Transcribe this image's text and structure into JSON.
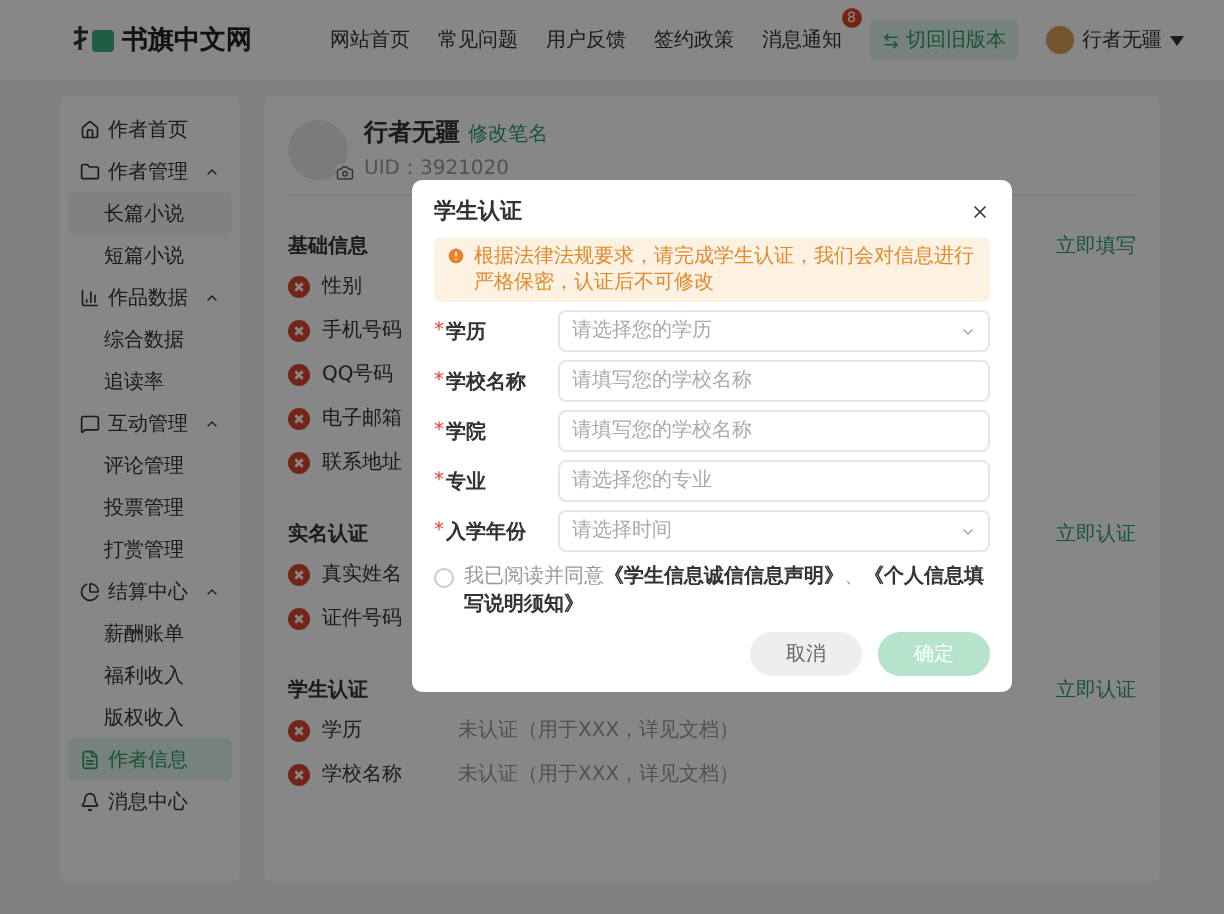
{
  "header": {
    "logo": "书旗中文网",
    "nav": [
      {
        "label": "网站首页"
      },
      {
        "label": "常见问题"
      },
      {
        "label": "用户反馈"
      },
      {
        "label": "签约政策"
      },
      {
        "label": "消息通知",
        "badge": "8"
      }
    ],
    "switch_button": "切回旧版本",
    "user": "行者无疆"
  },
  "sidebar": {
    "items": [
      {
        "label": "作者首页",
        "selected": false
      },
      {
        "label": "作者管理",
        "selected": false,
        "expanded": true,
        "children": [
          {
            "label": "长篇小说",
            "selected": false,
            "hovered": true
          },
          {
            "label": "短篇小说",
            "selected": false,
            "hovered": false
          }
        ]
      },
      {
        "label": "作品数据",
        "selected": false,
        "expanded": true,
        "children": [
          {
            "label": "综合数据",
            "selected": false,
            "hovered": false
          },
          {
            "label": "追读率",
            "selected": false,
            "hovered": false
          }
        ]
      },
      {
        "label": "互动管理",
        "selected": false,
        "expanded": true,
        "children": [
          {
            "label": "评论管理",
            "selected": false,
            "hovered": false
          },
          {
            "label": "投票管理",
            "selected": false,
            "hovered": false
          },
          {
            "label": "打赏管理",
            "selected": false,
            "hovered": false
          }
        ]
      },
      {
        "label": "结算中心",
        "selected": false,
        "expanded": true,
        "children": [
          {
            "label": "薪酬账单",
            "selected": false,
            "hovered": false
          },
          {
            "label": "福利收入",
            "selected": false,
            "hovered": false
          },
          {
            "label": "版权收入",
            "selected": false,
            "hovered": false
          }
        ]
      },
      {
        "label": "作者信息",
        "selected": true
      },
      {
        "label": "消息中心",
        "selected": false
      }
    ]
  },
  "profile": {
    "name": "行者无疆",
    "edit_link": "修改笔名",
    "uid": "UID：3921020"
  },
  "sections": [
    {
      "title": "基础信息",
      "action": "立即填写",
      "rows": [
        {
          "label": "性别",
          "verified": false
        },
        {
          "label": "手机号码",
          "verified": false
        },
        {
          "label": "QQ号码",
          "verified": false
        },
        {
          "label": "电子邮箱",
          "verified": false
        },
        {
          "label": "联系地址",
          "verified": false
        }
      ]
    },
    {
      "title": "实名认证",
      "action": "立即认证",
      "rows": [
        {
          "label": "真实姓名",
          "verified": false
        },
        {
          "label": "证件号码",
          "verified": false
        }
      ]
    },
    {
      "title": "学生认证",
      "action": "立即认证",
      "rows": [
        {
          "label": "学历",
          "verified": false,
          "value": "未认证（用于XXX，详见文档）"
        },
        {
          "label": "学校名称",
          "verified": false,
          "value": "未认证（用于XXX，详见文档）"
        }
      ]
    }
  ],
  "dialog": {
    "title": "学生认证",
    "notice": "根据法律法规要求，请完成学生认证，我们会对信息进行严格保密，认证后不可修改",
    "fields": [
      {
        "required_mark": "*",
        "label": "学历",
        "kind": "select",
        "placeholder": "请选择您的学历"
      },
      {
        "required_mark": "*",
        "label": "学校名称",
        "kind": "input",
        "placeholder": "请填写您的学校名称"
      },
      {
        "required_mark": "*",
        "label": "学院",
        "kind": "input",
        "placeholder": "请填写您的学校名称"
      },
      {
        "required_mark": "*",
        "label": "专业",
        "kind": "input",
        "placeholder": "请选择您的专业"
      },
      {
        "required_mark": "*",
        "label": "入学年份",
        "kind": "select",
        "placeholder": "请选择时间"
      }
    ],
    "agreement": {
      "checked": false,
      "text": "我已阅读并同意**《学生信息诚信信息声明》**、**《个人信息填写说明须知》**"
    },
    "buttons": [
      {
        "label": "取消",
        "kind": "secondary",
        "disabled": false
      },
      {
        "label": "确定",
        "kind": "primary",
        "disabled": true
      }
    ]
  }
}
